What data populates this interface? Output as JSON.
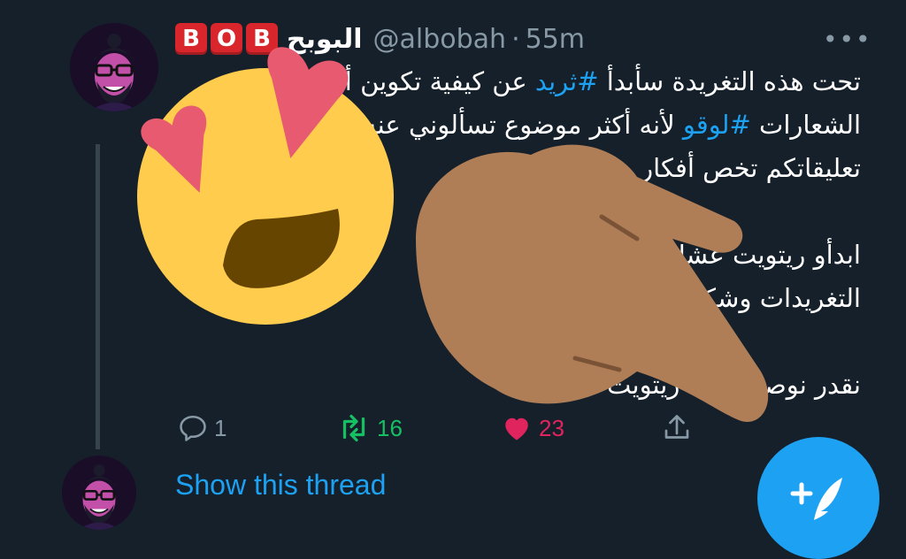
{
  "tweet": {
    "badge_letters": [
      "B",
      "O",
      "B"
    ],
    "display_name": "البوبح",
    "handle": "@albobah",
    "separator": "·",
    "time": "55m",
    "more_icon": "more-icon",
    "lines": [
      {
        "before": "تحت هذه التغريدة سأبدأ ",
        "tag": "#ثريد",
        "after": " عن كيفية تكوين أفكار"
      },
      {
        "before": "الشعارات ",
        "tag": "#لوقو",
        "after": " لأنه أكثر موضوع تسألوني عنه"
      },
      {
        "before": "تعليقاتكم تخص أفكار",
        "tag": "",
        "after": ""
      },
      {
        "before": "",
        "tag": "",
        "after": ""
      },
      {
        "before": "ابدأو ريتويت عشان يكون الثريد ظاهر",
        "tag": "",
        "after": ""
      },
      {
        "before": "التغريدات وشكرًا لدعمكم وحبكم",
        "tag": "",
        "after": ""
      },
      {
        "before": "",
        "tag": "",
        "after": ""
      },
      {
        "before": "نقدر نوصل 100 ريتويت",
        "tag": "",
        "after": ""
      }
    ]
  },
  "actions": {
    "reply_count": "1",
    "retweet_count": "16",
    "like_count": "23",
    "colors": {
      "reply": "#8899a6",
      "retweet": "#17bf63",
      "like": "#e0245e"
    }
  },
  "show_thread": "Show this thread",
  "fab": {
    "icon": "compose-tweet-icon",
    "glyph": "+"
  },
  "overlays": [
    "heart-eyes-emoji",
    "pointing-hand-emoji"
  ],
  "theme": {
    "background": "#15202b",
    "accent": "#1da1f2",
    "muted": "#8899a6"
  }
}
